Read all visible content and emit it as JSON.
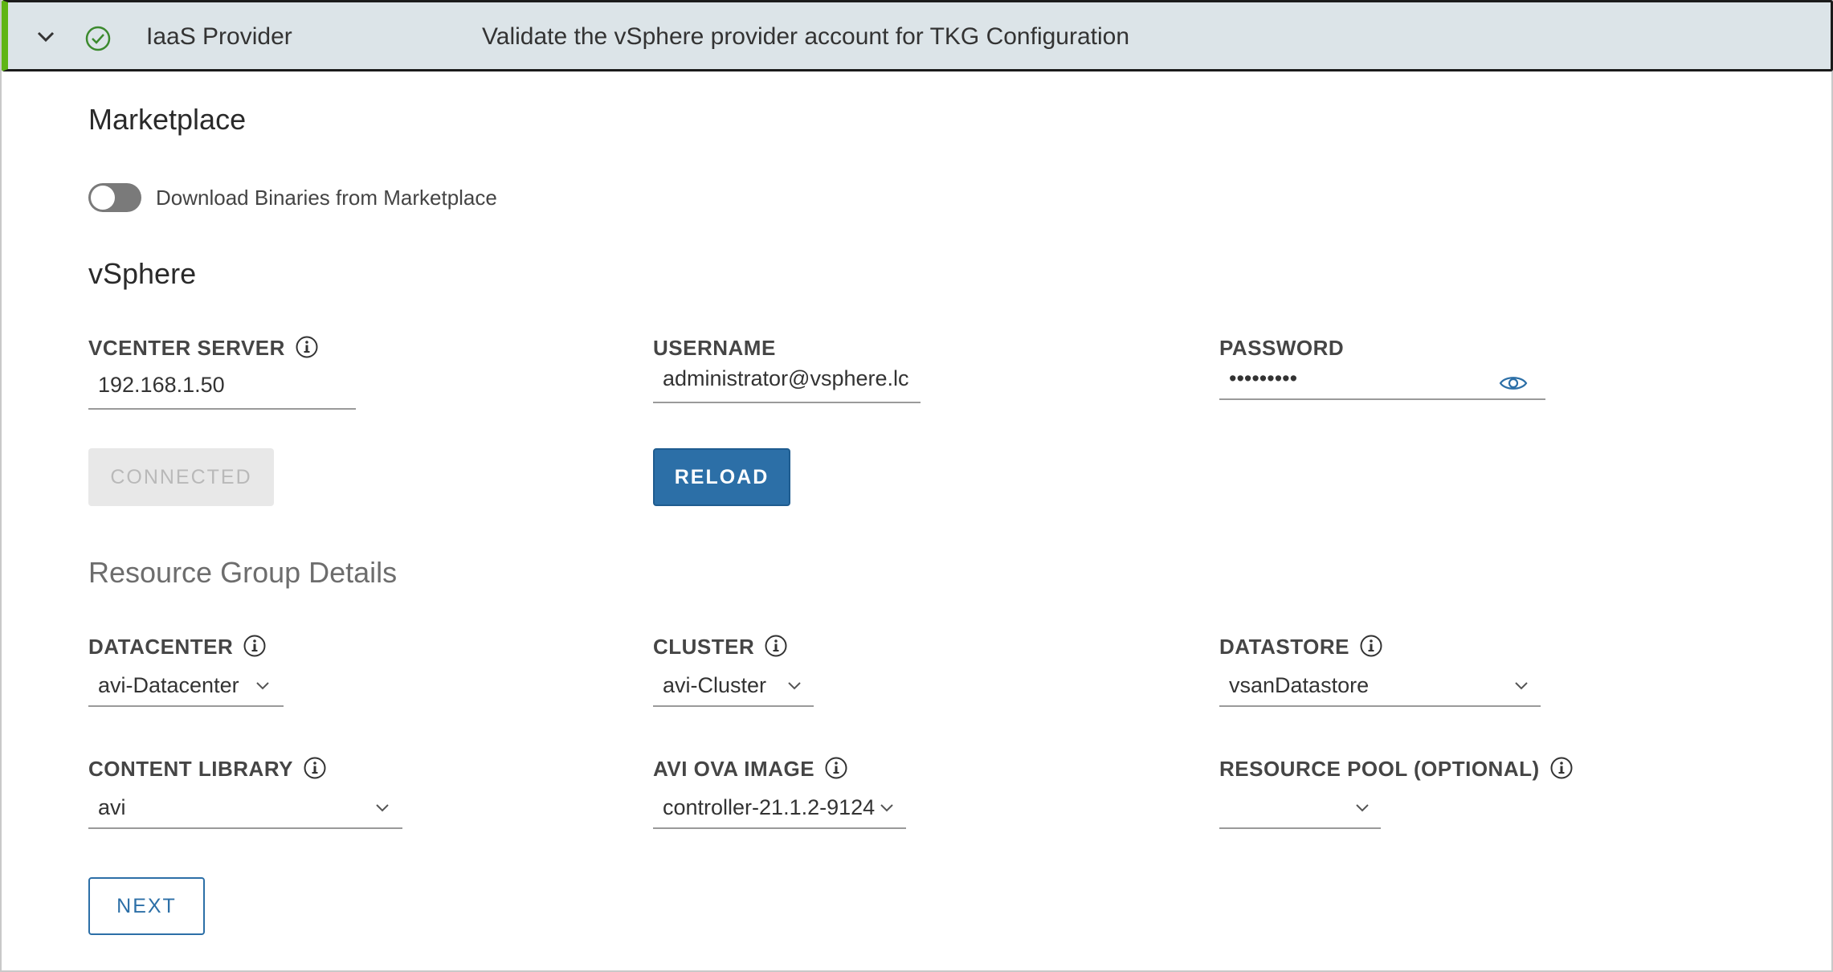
{
  "header": {
    "title": "IaaS Provider",
    "description": "Validate the vSphere provider account for TKG Configuration",
    "status_color": "#60b515"
  },
  "marketplace": {
    "title": "Marketplace",
    "toggle_label": "Download Binaries from Marketplace",
    "toggle_on": false
  },
  "vsphere": {
    "title": "vSphere",
    "vcenter": {
      "label": "VCENTER SERVER",
      "value": "192.168.1.50"
    },
    "username": {
      "label": "USERNAME",
      "value": "administrator@vsphere.lc"
    },
    "password": {
      "label": "PASSWORD",
      "value": "•••••••••"
    },
    "connected_label": "CONNECTED",
    "reload_label": "RELOAD"
  },
  "resource": {
    "title": "Resource Group Details",
    "datacenter": {
      "label": "DATACENTER",
      "value": "avi-Datacenter"
    },
    "cluster": {
      "label": "CLUSTER",
      "value": "avi-Cluster"
    },
    "datastore": {
      "label": "DATASTORE",
      "value": "vsanDatastore"
    },
    "content_library": {
      "label": "CONTENT LIBRARY",
      "value": "avi"
    },
    "avi_ova_image": {
      "label": "AVI OVA IMAGE",
      "value": "controller-21.1.2-9124"
    },
    "resource_pool": {
      "label": "RESOURCE POOL (OPTIONAL)",
      "value": ""
    }
  },
  "next_label": "NEXT",
  "colors": {
    "primary": "#2c6fa7",
    "success": "#60b515",
    "header_bg": "#dce4e8"
  }
}
